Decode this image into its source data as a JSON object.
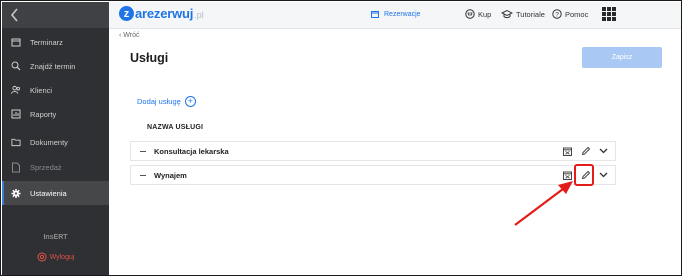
{
  "sidebar": {
    "items": [
      {
        "label": "Terminarz",
        "icon": "calendar-icon",
        "state": "normal"
      },
      {
        "label": "Znajdź termin",
        "icon": "search-icon",
        "state": "normal"
      },
      {
        "label": "Klienci",
        "icon": "users-icon",
        "state": "normal"
      },
      {
        "label": "Raporty",
        "icon": "reports-icon",
        "state": "normal"
      },
      {
        "label": "Dokumenty",
        "icon": "folder-icon",
        "state": "normal"
      },
      {
        "label": "Sprzedaż",
        "icon": "document-icon",
        "state": "disabled"
      },
      {
        "label": "Ustawienia",
        "icon": "gear-icon",
        "state": "active"
      }
    ],
    "brand": "InsERT",
    "logout_label": "Wyloguj"
  },
  "topbar": {
    "logo_letter": "z",
    "logo_word": "arezerwuj",
    "logo_tld": ".pl",
    "nav_reservations": "Rezerwacje",
    "nav_buy": "Kup",
    "nav_tutorials": "Tutoriale",
    "nav_help": "Pomoc"
  },
  "page": {
    "back_label": "‹ Wróć",
    "title": "Usługi",
    "save_label": "Zapisz",
    "add_service_label": "Dodaj usługę",
    "column_header": "NAZWA USŁUGI"
  },
  "services": [
    {
      "name": "Konsultacja lekarska"
    },
    {
      "name": "Wynajem"
    }
  ],
  "colors": {
    "accent": "#1f74e8",
    "sidebar_bg": "#2f3033",
    "save_disabled": "#a9c9f4",
    "annotation_red": "#e21b1b"
  }
}
